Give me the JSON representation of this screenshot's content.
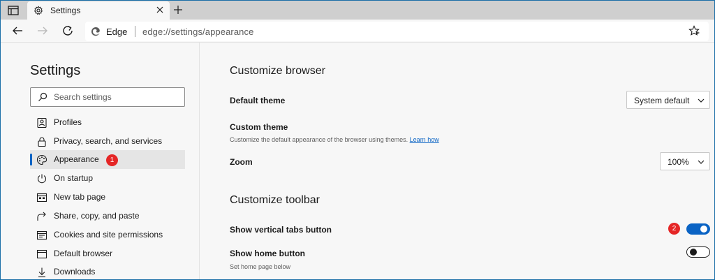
{
  "tab": {
    "title": "Settings"
  },
  "toolbar": {
    "browser_name": "Edge",
    "url": "edge://settings/appearance"
  },
  "sidebar": {
    "title": "Settings",
    "search_placeholder": "Search settings",
    "items": [
      {
        "label": "Profiles",
        "icon": "profile-icon",
        "active": false
      },
      {
        "label": "Privacy, search, and services",
        "icon": "lock-icon",
        "active": false
      },
      {
        "label": "Appearance",
        "icon": "palette-icon",
        "active": true,
        "badge": "1"
      },
      {
        "label": "On startup",
        "icon": "power-icon",
        "active": false
      },
      {
        "label": "New tab page",
        "icon": "new-tab-page-icon",
        "active": false
      },
      {
        "label": "Share, copy, and paste",
        "icon": "share-icon",
        "active": false
      },
      {
        "label": "Cookies and site permissions",
        "icon": "cookies-icon",
        "active": false
      },
      {
        "label": "Default browser",
        "icon": "default-browser-icon",
        "active": false
      },
      {
        "label": "Downloads",
        "icon": "download-icon",
        "active": false
      }
    ]
  },
  "main": {
    "customize_browser": {
      "title": "Customize browser",
      "default_theme": {
        "label": "Default theme",
        "value": "System default"
      },
      "custom_theme": {
        "label": "Custom theme",
        "description": "Customize the default appearance of the browser using themes.",
        "link": "Learn how"
      },
      "zoom": {
        "label": "Zoom",
        "value": "100%"
      }
    },
    "customize_toolbar": {
      "title": "Customize toolbar",
      "vertical_tabs": {
        "label": "Show vertical tabs button",
        "enabled": true,
        "badge": "2"
      },
      "home_button": {
        "label": "Show home button",
        "enabled": false,
        "description": "Set home page below"
      }
    }
  },
  "colors": {
    "accent": "#0a63c4",
    "badge": "#e52626",
    "tabstrip": "#cfcfcf",
    "page_bg": "#f7f7f7"
  }
}
